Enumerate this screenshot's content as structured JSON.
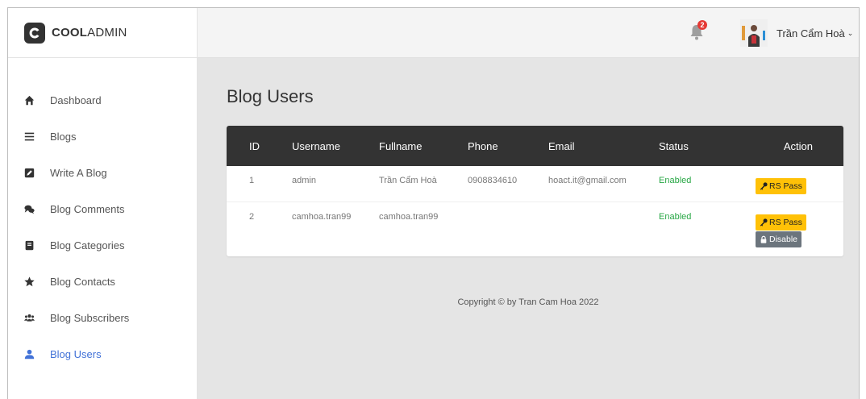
{
  "brand": {
    "bold": "COOL",
    "light": "ADMIN",
    "badge_letter": "C"
  },
  "sidebar": {
    "items": [
      {
        "label": "Dashboard",
        "icon": "home-icon"
      },
      {
        "label": "Blogs",
        "icon": "list-icon"
      },
      {
        "label": "Write A Blog",
        "icon": "edit-icon"
      },
      {
        "label": "Blog Comments",
        "icon": "comments-icon"
      },
      {
        "label": "Blog Categories",
        "icon": "book-icon"
      },
      {
        "label": "Blog Contacts",
        "icon": "star-icon"
      },
      {
        "label": "Blog Subscribers",
        "icon": "users-icon"
      },
      {
        "label": "Blog Users",
        "icon": "user-icon",
        "active": true
      }
    ]
  },
  "header": {
    "notifications_count": "2",
    "user_name": "Trần Cẩm Hoà",
    "caret": "⌄"
  },
  "main": {
    "title": "Blog Users",
    "columns": {
      "id": "ID",
      "username": "Username",
      "fullname": "Fullname",
      "phone": "Phone",
      "email": "Email",
      "status": "Status",
      "action": "Action"
    },
    "rows": [
      {
        "id": "1",
        "username": "admin",
        "fullname": "Trần Cẩm Hoà",
        "phone": "0908834610",
        "email": "hoact.it@gmail.com",
        "status": "Enabled"
      },
      {
        "id": "2",
        "username": "camhoa.tran99",
        "fullname": "camhoa.tran99",
        "phone": "",
        "email": "",
        "status": "Enabled"
      }
    ],
    "rs_pass_label": "RS Pass",
    "disable_label": "Disable"
  },
  "footer": {
    "copyright": "Copyright © by Tran Cam Hoa 2022"
  },
  "colors": {
    "active": "#4272d7",
    "table_header": "#333333",
    "status_enabled": "#28a745",
    "btn_warning": "#ffc107",
    "btn_secondary": "#6c757d",
    "badge": "#e53935"
  }
}
